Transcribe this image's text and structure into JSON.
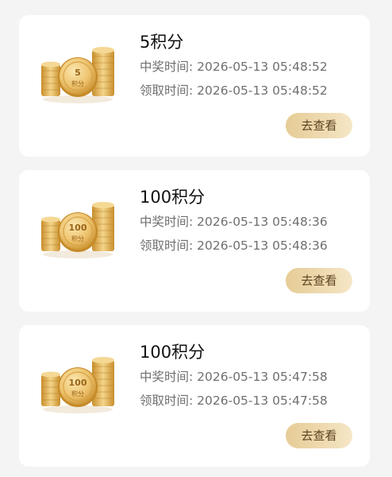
{
  "records": [
    {
      "coin_label_top": "5",
      "coin_label_bottom": "积分",
      "title": "5积分",
      "win_time": "中奖时间: 2026-05-13 05:48:52",
      "claim_time": "领取时间: 2026-05-13 05:48:52",
      "action_label": "去查看"
    },
    {
      "coin_label_top": "100",
      "coin_label_bottom": "积分",
      "title": "100积分",
      "win_time": "中奖时间: 2026-05-13 05:48:36",
      "claim_time": "领取时间: 2026-05-13 05:48:36",
      "action_label": "去查看"
    },
    {
      "coin_label_top": "100",
      "coin_label_bottom": "积分",
      "title": "100积分",
      "win_time": "中奖时间: 2026-05-13 05:47:58",
      "claim_time": "领取时间: 2026-05-13 05:47:58",
      "action_label": "去查看"
    }
  ],
  "colors": {
    "page_background": "#f4f4f4",
    "card_background": "#ffffff",
    "button_gradient_start": "#e6cc96",
    "button_gradient_end": "#f5e6c6",
    "coin_gold": "#e2b25a"
  },
  "icons": {
    "coin_stack": "coin-stack-icon"
  }
}
